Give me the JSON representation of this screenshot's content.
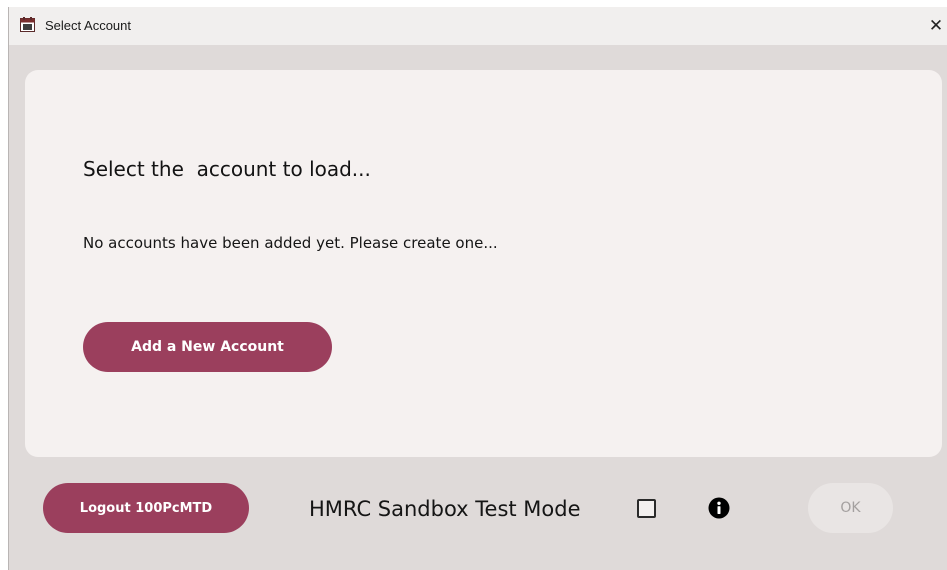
{
  "window": {
    "title": "Select Account",
    "close_glyph": "✕",
    "icon": "app-calendar-icon"
  },
  "main": {
    "heading": "Select the  account to load...",
    "message": "No accounts have been added yet. Please create one...",
    "add_button_label": "Add a New Account"
  },
  "footer": {
    "logout_label": "Logout 100PcMTD",
    "sandbox_label": "HMRC Sandbox Test Mode",
    "sandbox_checked": false,
    "info_icon": "info-icon",
    "ok_label": "OK",
    "ok_enabled": false
  },
  "colors": {
    "accent": "#9b3f5d",
    "window_bg": "#dfdad9",
    "card_bg": "#f5f1f0",
    "titlebar_bg": "#f1efee",
    "disabled_button_bg": "#e9e5e4",
    "disabled_button_text": "#a4a09f"
  }
}
